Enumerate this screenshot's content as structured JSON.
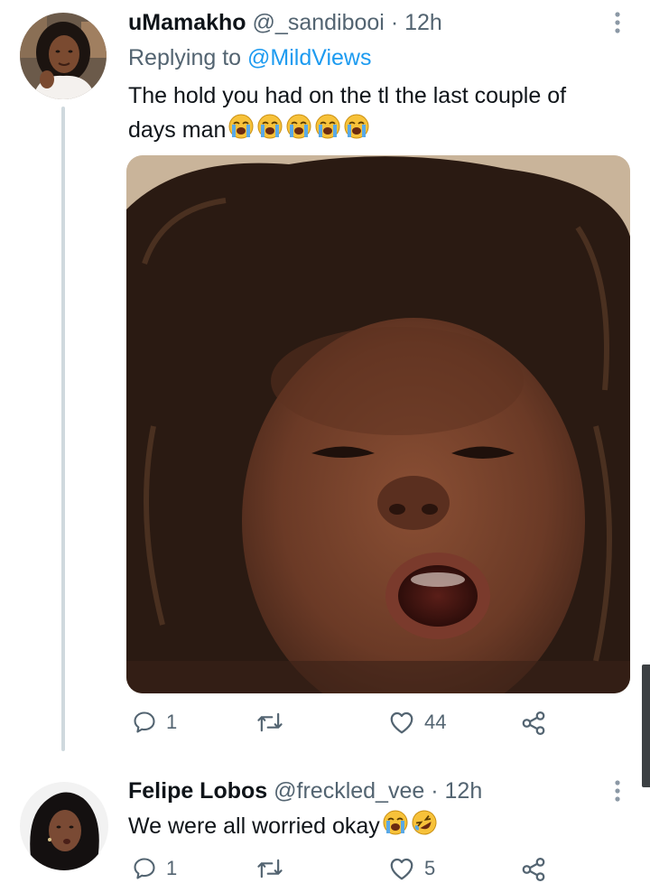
{
  "tweet1": {
    "display_name": "uMamakho",
    "handle": "@_sandibooi",
    "separator": "·",
    "time": "12h",
    "replying_prefix": "Replying to",
    "replying_to": "@MildViews",
    "text_line1": "The hold you had on the tl the last couple of",
    "text_line2": "days man",
    "emojis": [
      "loudly-crying-face",
      "loudly-crying-face",
      "loudly-crying-face",
      "loudly-crying-face",
      "loudly-crying-face"
    ],
    "stats": {
      "replies": "1",
      "retweets": "",
      "likes": "44"
    }
  },
  "tweet2": {
    "display_name": "Felipe Lobos",
    "handle": "@freckled_vee",
    "separator": "·",
    "time": "12h",
    "text": "We were all worried okay",
    "emojis": [
      "loudly-crying-face",
      "rolling-on-floor-laughing-face"
    ],
    "stats": {
      "replies": "1",
      "retweets": "",
      "likes": "5"
    }
  },
  "colors": {
    "text": "#0f1419",
    "secondary": "#536471",
    "link": "#1d9bf0",
    "thread_line": "#cfd9de",
    "emoji_yellow": "#f7c23a",
    "emoji_tear": "#5aa9e6"
  },
  "icons": [
    "reply-icon",
    "retweet-icon",
    "like-icon",
    "share-icon",
    "more-options-icon"
  ]
}
